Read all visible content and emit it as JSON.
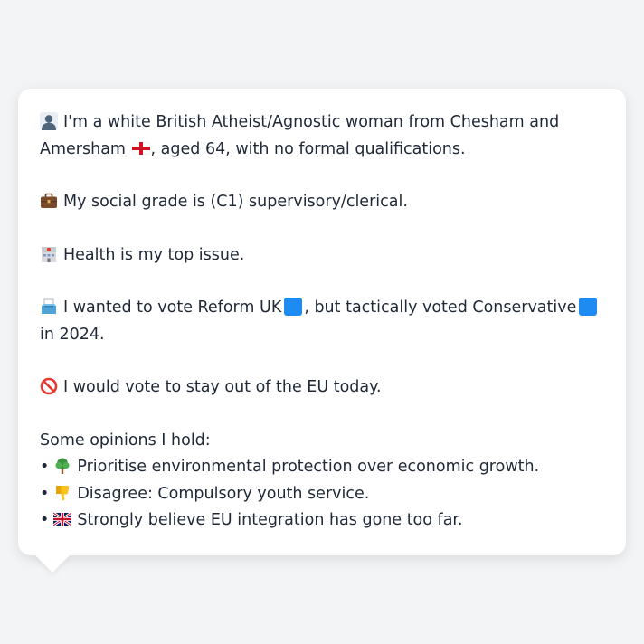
{
  "colors": {
    "reform_square": "#1d8bf1",
    "conservative_square": "#1d8bf1",
    "background": "#f3f4f6",
    "bubble": "#ffffff",
    "text": "#1f2937"
  },
  "intro": {
    "icon": "person-silhouette-icon",
    "text_before_flag": "I'm a white British Atheist/Agnostic woman from Chesham and Amersham",
    "flag_icon": "england-flag-icon",
    "text_after_flag": ", aged 64, with no formal qualifications."
  },
  "social": {
    "icon": "briefcase-icon",
    "text": "My social grade is (C1) supervisory/clerical."
  },
  "health": {
    "icon": "hospital-icon",
    "text": "Health is my top issue."
  },
  "vote": {
    "icon": "ballot-box-icon",
    "text_1": "I wanted to vote Reform UK",
    "text_2": ", but tactically voted Conservative",
    "text_3": " in 2024."
  },
  "eu": {
    "icon": "prohibited-icon",
    "text": "I would vote to stay out of the EU today."
  },
  "opinions": {
    "title": "Some opinions I hold:",
    "bullet": "•",
    "items": [
      {
        "icon": "tree-icon",
        "text": "Prioritise environmental protection over economic growth."
      },
      {
        "icon": "thumbs-down-icon",
        "text": "Disagree: Compulsory youth service."
      },
      {
        "icon": "uk-flag-icon",
        "text": "Strongly believe EU integration has gone too far."
      }
    ]
  }
}
